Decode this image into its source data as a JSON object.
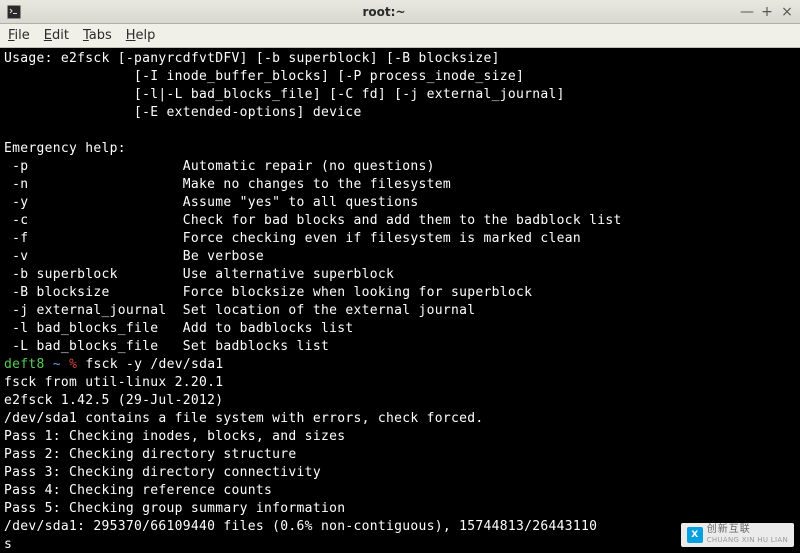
{
  "window": {
    "title": "root:~",
    "controls": {
      "minimize": "—",
      "maximize": "+",
      "close": "×"
    }
  },
  "menubar": {
    "file": {
      "accel": "F",
      "rest": "ile"
    },
    "edit": {
      "accel": "E",
      "rest": "dit"
    },
    "tabs": {
      "accel": "T",
      "rest": "abs"
    },
    "help": {
      "accel": "H",
      "rest": "elp"
    }
  },
  "terminal": {
    "l01": "Usage: e2fsck [-panyrcdfvtDFV] [-b superblock] [-B blocksize]",
    "l02": "                [-I inode_buffer_blocks] [-P process_inode_size]",
    "l03": "                [-l|-L bad_blocks_file] [-C fd] [-j external_journal]",
    "l04": "                [-E extended-options] device",
    "l05": "",
    "l06": "Emergency help:",
    "l07": " -p                   Automatic repair (no questions)",
    "l08": " -n                   Make no changes to the filesystem",
    "l09": " -y                   Assume \"yes\" to all questions",
    "l10": " -c                   Check for bad blocks and add them to the badblock list",
    "l11": " -f                   Force checking even if filesystem is marked clean",
    "l12": " -v                   Be verbose",
    "l13": " -b superblock        Use alternative superblock",
    "l14": " -B blocksize         Force blocksize when looking for superblock",
    "l15": " -j external_journal  Set location of the external journal",
    "l16": " -l bad_blocks_file   Add to badblocks list",
    "l17": " -L bad_blocks_file   Set badblocks list",
    "prompt_host": "deft8",
    "prompt_tilde": "~",
    "prompt_sym": "%",
    "cmd": "fsck -y /dev/sda1",
    "l19": "fsck from util-linux 2.20.1",
    "l20": "e2fsck 1.42.5 (29-Jul-2012)",
    "l21": "/dev/sda1 contains a file system with errors, check forced.",
    "l22": "Pass 1: Checking inodes, blocks, and sizes",
    "l23": "Pass 2: Checking directory structure",
    "l24": "Pass 3: Checking directory connectivity",
    "l25": "Pass 4: Checking reference counts",
    "l26": "Pass 5: Checking group summary information",
    "l27": "/dev/sda1: 295370/66109440 files (0.6% non-contiguous), 15744813/26443110",
    "l28": "s"
  },
  "watermark": {
    "cn": "创新互联",
    "en": "CHUANG XIN HU LIAN"
  }
}
